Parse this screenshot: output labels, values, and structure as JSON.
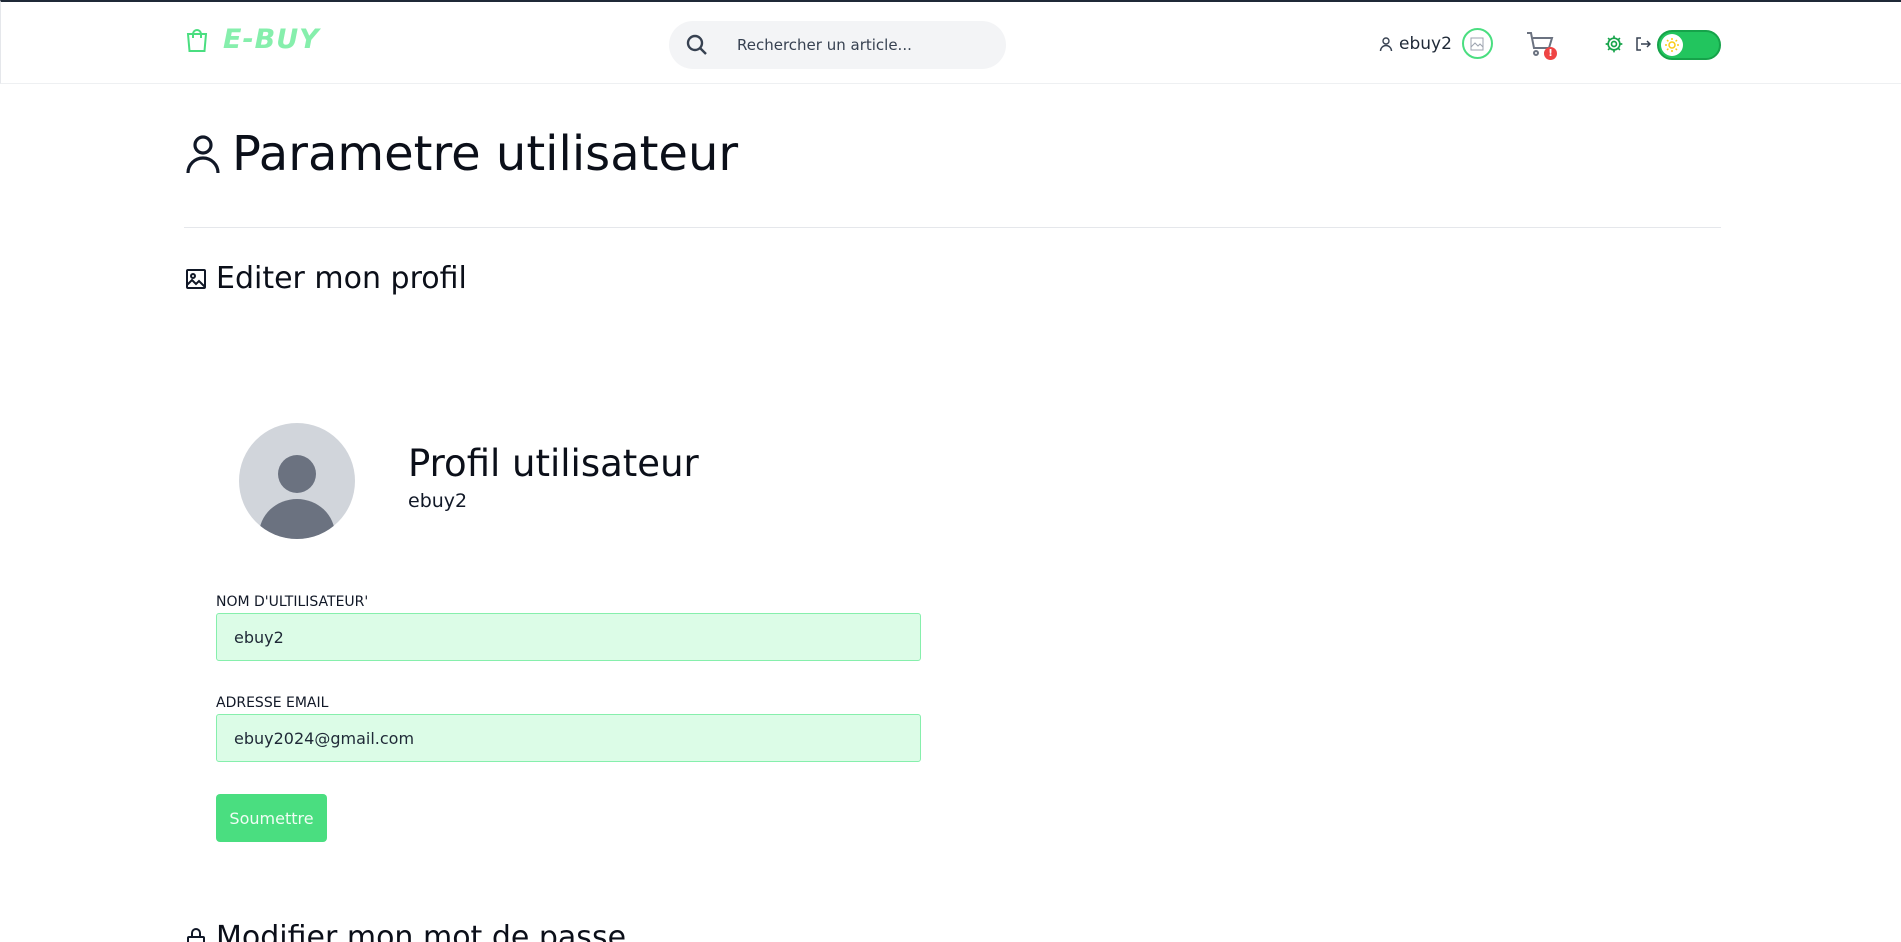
{
  "header": {
    "brand": "E-BUY",
    "search_placeholder": "Rechercher un article...",
    "username": "ebuy2",
    "cart_badge": "!",
    "theme_toggle": "light"
  },
  "page": {
    "title": "Parametre utilisateur"
  },
  "edit_profile": {
    "title": "Editer mon profil",
    "profile_heading": "Profil utilisateur",
    "profile_username": "ebuy2",
    "username_label": "NOM D'ULTILISATEUR'",
    "username_value": "ebuy2",
    "email_label": "ADRESSE EMAIL",
    "email_value": "ebuy2024@gmail.com",
    "submit_label": "Soumettre"
  },
  "password_section": {
    "title": "Modifier mon mot de passe"
  },
  "colors": {
    "accent": "#4ade80",
    "field_bg": "#dcfce7",
    "badge": "#ef4444"
  }
}
